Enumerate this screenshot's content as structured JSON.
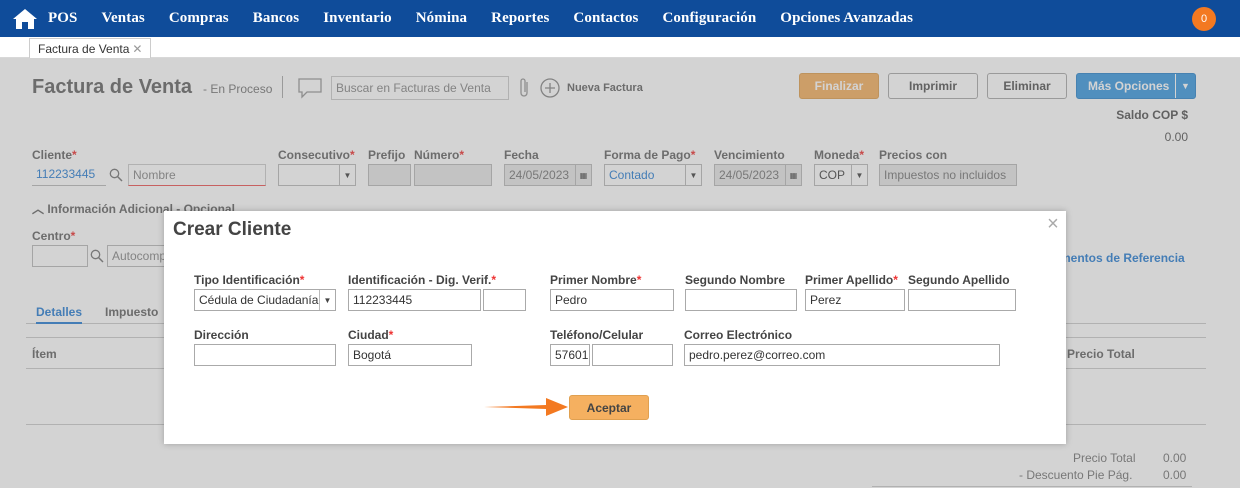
{
  "nav": {
    "items": [
      "POS",
      "Ventas",
      "Compras",
      "Bancos",
      "Inventario",
      "Nómina",
      "Reportes",
      "Contactos",
      "Configuración",
      "Opciones Avanzadas"
    ],
    "notification_count": "0",
    "home_icon": "home-icon"
  },
  "tabs": {
    "active_label": "Factura de Venta",
    "close_glyph": "✕"
  },
  "header": {
    "title": "Factura de Venta",
    "status": "- En Proceso",
    "search_placeholder": "Buscar en Facturas de Venta",
    "nueva_factura": "Nueva Factura",
    "buttons": {
      "finalizar": "Finalizar",
      "imprimir": "Imprimir",
      "eliminar": "Eliminar",
      "mas_opciones": "Más Opciones"
    },
    "saldo_label": "Saldo COP $",
    "saldo_value": "0.00"
  },
  "form": {
    "cliente_label": "Cliente",
    "cliente_id": "112233445",
    "cliente_nombre_placeholder": "Nombre",
    "consecutivo_label": "Consecutivo",
    "prefijo_label": "Prefijo",
    "numero_label": "Número",
    "fecha_label": "Fecha",
    "fecha_value": "24/05/2023",
    "forma_pago_label": "Forma de Pago",
    "forma_pago_value": "Contado",
    "vencimiento_label": "Vencimiento",
    "vencimiento_value": "24/05/2023",
    "moneda_label": "Moneda",
    "moneda_value": "COP",
    "precios_label": "Precios con",
    "precios_value": "Impuestos no incluidos",
    "info_adicional": "Información Adicional - Opcional",
    "centro_label": "Centro",
    "autocomp_placeholder": "Autocomp",
    "doc_referencia": "mentos de Referencia"
  },
  "details": {
    "tabs": [
      "Detalles",
      "Impuesto"
    ],
    "col_item": "Ítem",
    "col_precio_total": "Precio Total"
  },
  "totals": [
    {
      "label": "Precio Total",
      "value": "0.00"
    },
    {
      "label": "- Descuento Pie Pág.",
      "value": "0.00"
    }
  ],
  "modal": {
    "title": "Crear Cliente",
    "fields": {
      "tipo_id_label": "Tipo Identificación",
      "tipo_id_value": "Cédula de Ciudadanía",
      "identificacion_label": "Identificación - Dig. Verif.",
      "identificacion_value": "112233445",
      "dv_value": "",
      "primer_nombre_label": "Primer Nombre",
      "primer_nombre_value": "Pedro",
      "segundo_nombre_label": "Segundo Nombre",
      "segundo_nombre_value": "",
      "primer_apellido_label": "Primer Apellido",
      "primer_apellido_value": "Perez",
      "segundo_apellido_label": "Segundo Apellido",
      "segundo_apellido_value": "",
      "direccion_label": "Dirección",
      "direccion_value": "",
      "ciudad_label": "Ciudad",
      "ciudad_value": "Bogotá",
      "telefono_label": "Teléfono/Celular",
      "telefono_indicativo": "57601",
      "telefono_value": "",
      "correo_label": "Correo Electrónico",
      "correo_value": "pedro.perez@correo.com"
    },
    "aceptar": "Aceptar"
  },
  "colors": {
    "nav_bg": "#0f4c9a",
    "accent_orange": "#f5b060",
    "arrow": "#f37921",
    "link_blue": "#2a7fd4"
  }
}
